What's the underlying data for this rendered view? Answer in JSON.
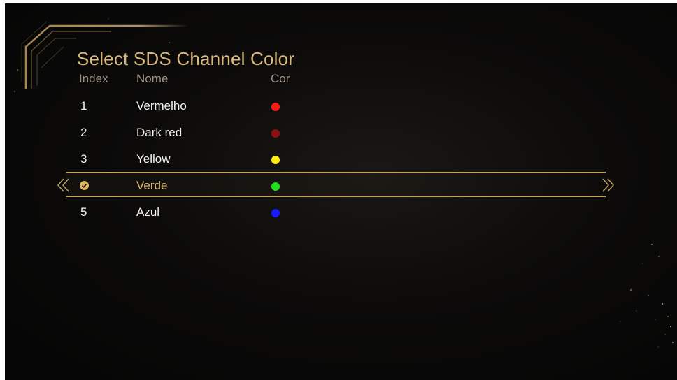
{
  "screen": {
    "title": "Select SDS Channel Color"
  },
  "columns": {
    "index": "Index",
    "name": "Nome",
    "color": "Cor"
  },
  "rows": [
    {
      "index": "1",
      "name": "Vermelho",
      "color": "#ff1a1a",
      "selected": false
    },
    {
      "index": "2",
      "name": "Dark red",
      "color": "#8c1010",
      "selected": false
    },
    {
      "index": "3",
      "name": "Yellow",
      "color": "#ffeb0f",
      "selected": false
    },
    {
      "index": "4",
      "name": "Verde",
      "color": "#22e01f",
      "selected": true
    },
    {
      "index": "5",
      "name": "Azul",
      "color": "#1a1aff",
      "selected": false
    }
  ],
  "colors": {
    "accent": "#d8b77c",
    "selection_line": "#c4a368",
    "header_text": "#9e9282",
    "row_text": "#f2f2f2",
    "selected_text": "#e2bd74"
  },
  "icons": {
    "selected_marker": "check-circle-icon",
    "nav_left": "double-chevron-left-icon",
    "nav_right": "double-chevron-right-icon"
  }
}
